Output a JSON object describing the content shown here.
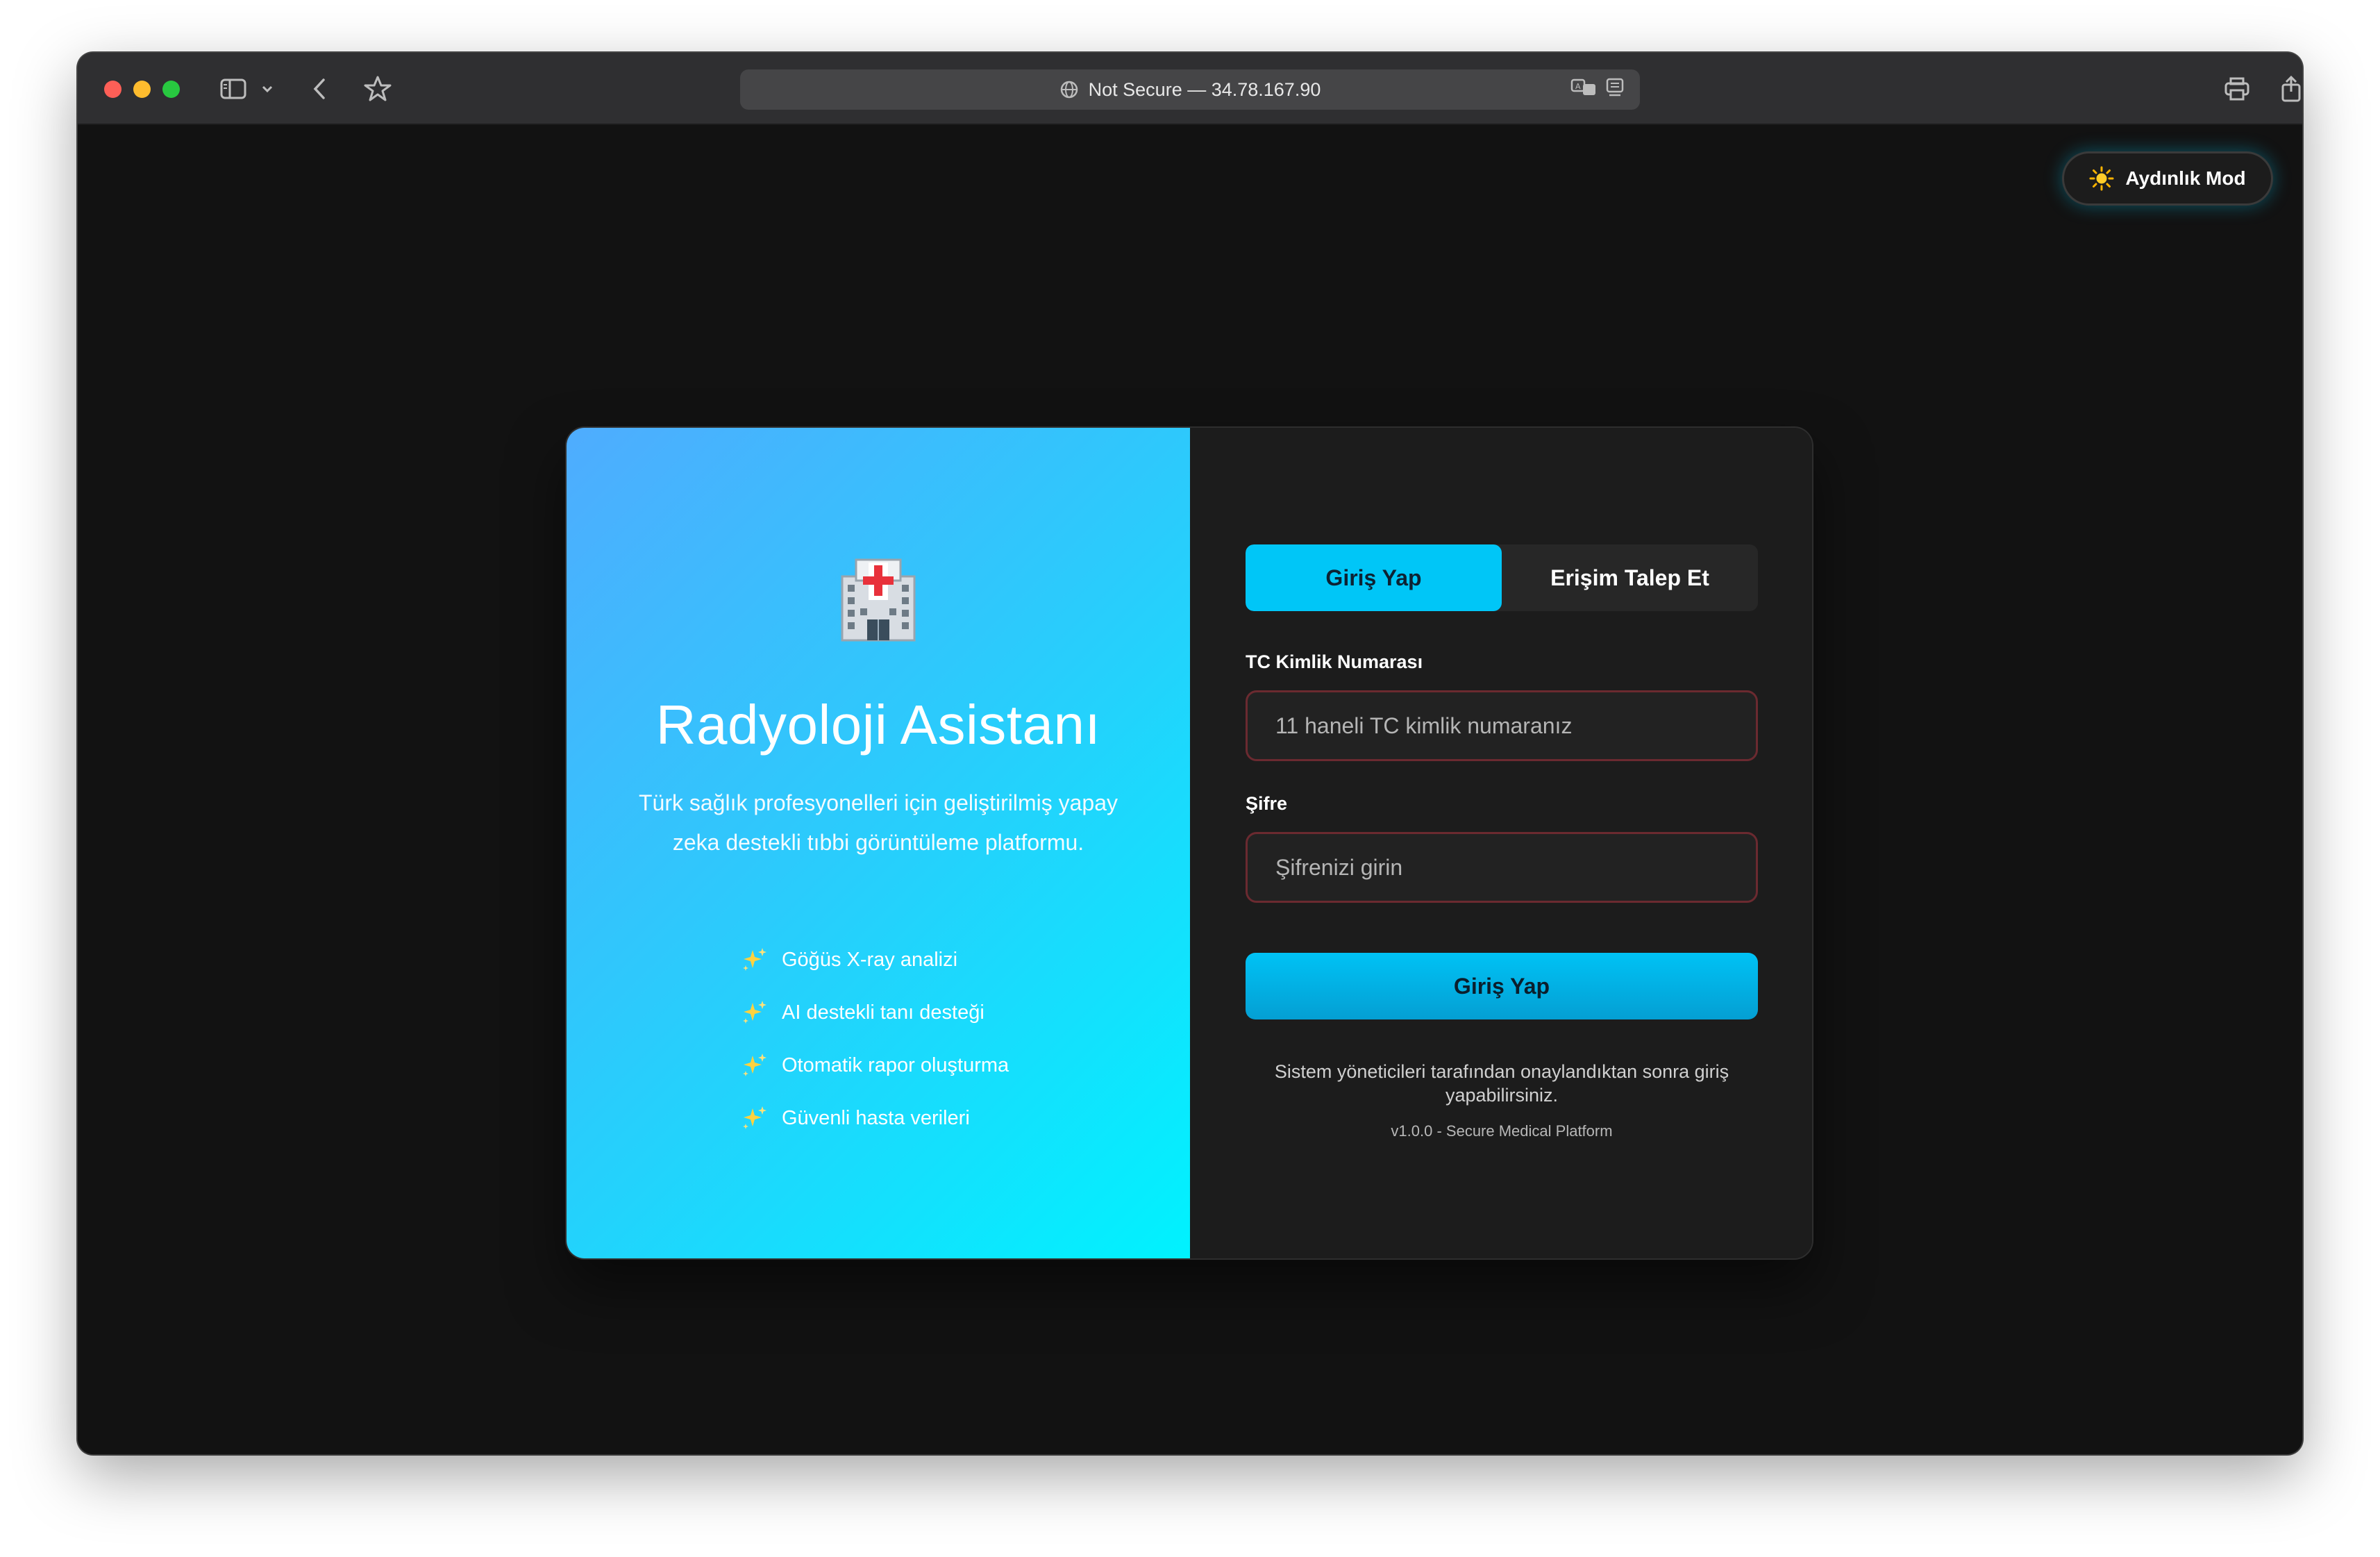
{
  "browser": {
    "address_text": "Not Secure — 34.78.167.90",
    "icons": [
      "sidebar-icon",
      "chevron-down-icon",
      "back-icon",
      "bookmark-star-icon",
      "globe-icon",
      "translate-icon",
      "reader-icon",
      "print-icon",
      "share-icon",
      "new-tab-plus-icon"
    ]
  },
  "theme_toggle": {
    "icon": "sun-icon",
    "label": "Aydınlık Mod"
  },
  "hero": {
    "logo_icon": "hospital-icon",
    "title": "Radyoloji Asistanı",
    "description": "Türk sağlık profesyonelleri için geliştirilmiş yapay zeka destekli tıbbi görüntüleme platformu.",
    "feature_icon": "sparkles-icon",
    "features": [
      "Göğüs X-ray analizi",
      "AI destekli tanı desteği",
      "Otomatik rapor oluşturma",
      "Güvenli hasta verileri"
    ]
  },
  "form": {
    "tabs": [
      {
        "label": "Giriş Yap",
        "active": true
      },
      {
        "label": "Erişim Talep Et",
        "active": false
      }
    ],
    "tc_label": "TC Kimlik Numarası",
    "tc_placeholder": "11 haneli TC kimlik numaranız",
    "tc_value": "",
    "password_label": "Şifre",
    "password_placeholder": "Şifrenizi girin",
    "password_value": "",
    "submit_label": "Giriş Yap",
    "note": "Sistem yöneticileri tarafından onaylandıktan sonra giriş yapabilirsiniz.",
    "version": "v1.0.0 - Secure Medical Platform"
  },
  "colors": {
    "accent": "#00c6f7",
    "hero_gradient_start": "#4facfe",
    "hero_gradient_end": "#00f2fe",
    "input_border": "#6b2a30",
    "page_bg": "#121212",
    "card_bg": "#1c1c1c"
  }
}
